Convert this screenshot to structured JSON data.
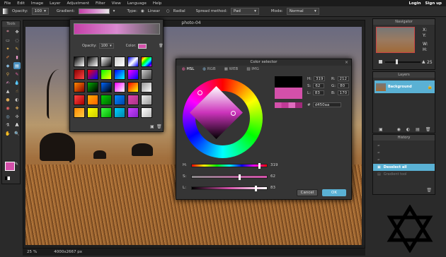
{
  "menubar": {
    "items": [
      "File",
      "Edit",
      "Image",
      "Layer",
      "Adjustment",
      "Filter",
      "View",
      "Language",
      "Help"
    ],
    "login": "Login",
    "signup": "Sign up"
  },
  "options": {
    "opacity_label": "Opacity:",
    "opacity_value": "100",
    "gradient_label": "Gradient:",
    "type_label": "Type:",
    "type_linear": "Linear",
    "type_radial": "Radial",
    "spread_label": "Spread method:",
    "spread_value": "Pad",
    "mode_label": "Mode:",
    "mode_value": "Normal"
  },
  "tools": {
    "title": "Tools"
  },
  "doc": {
    "title": "photo-04",
    "zoom": "25",
    "size": "4000x2667 px"
  },
  "gradient_popup": {
    "opacity_label": "Opacity:",
    "opacity_value": "100",
    "color_label": "Color:"
  },
  "navigator": {
    "title": "Navigator",
    "x_label": "X:",
    "y_label": "Y:",
    "w_label": "W:",
    "h_label": "H:",
    "zoom": "25"
  },
  "layers": {
    "title": "Layers",
    "items": [
      {
        "name": "Background"
      }
    ]
  },
  "history": {
    "title": "History",
    "items": [
      "",
      "",
      "",
      "Deselect all",
      "Gradient tool"
    ]
  },
  "color_selector": {
    "title": "Color selector",
    "tabs": [
      "HSL",
      "RGB",
      "WEB",
      "IMG"
    ],
    "h_label": "H:",
    "h": "319",
    "s_label": "S:",
    "s": "62",
    "l_label": "L:",
    "l": "83",
    "r_label": "R:",
    "r": "212",
    "g_label": "G:",
    "g": "80",
    "b_label": "B:",
    "b": "170",
    "hex_label": "#",
    "hex": "d450aa",
    "cancel": "Cancel",
    "ok": "OK"
  },
  "colors": {
    "accent": "#5ab1d4",
    "picked": "#d450aa"
  }
}
